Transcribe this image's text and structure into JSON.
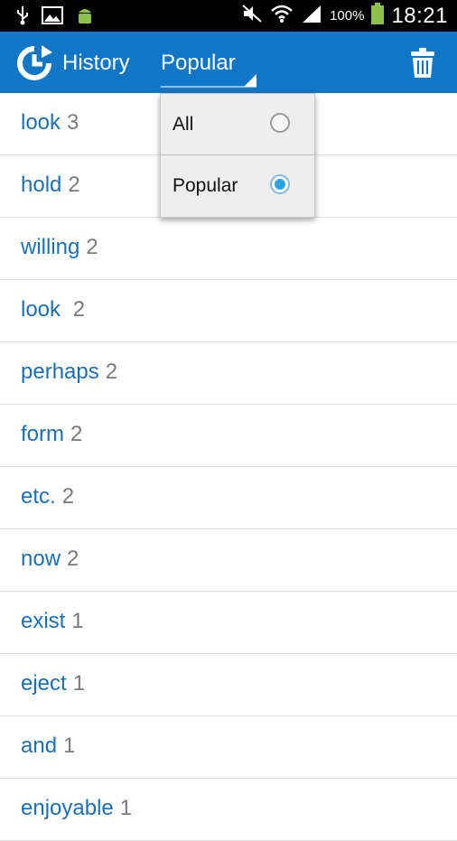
{
  "status_bar": {
    "battery_percent": "100%",
    "time": "18:21",
    "icons": [
      "usb-icon",
      "image-icon",
      "android-icon",
      "mute-icon",
      "wifi-icon",
      "signal-icon",
      "battery-icon"
    ]
  },
  "action_bar": {
    "title": "History",
    "spinner_selected": "Popular",
    "icons": [
      "history-icon",
      "trash-icon"
    ],
    "color": "#1176c6"
  },
  "dropdown": {
    "options": [
      {
        "label": "All",
        "selected": false
      },
      {
        "label": "Popular",
        "selected": true
      }
    ]
  },
  "history": [
    {
      "word": "look",
      "count": "3"
    },
    {
      "word": "hold",
      "count": "2"
    },
    {
      "word": "willing",
      "count": "2"
    },
    {
      "word": "look ",
      "count": "2"
    },
    {
      "word": "perhaps",
      "count": "2"
    },
    {
      "word": "form",
      "count": "2"
    },
    {
      "word": "etc.",
      "count": "2"
    },
    {
      "word": "now",
      "count": "2"
    },
    {
      "word": "exist",
      "count": "1"
    },
    {
      "word": "eject",
      "count": "1"
    },
    {
      "word": "and",
      "count": "1"
    },
    {
      "word": "enjoyable",
      "count": "1"
    }
  ]
}
